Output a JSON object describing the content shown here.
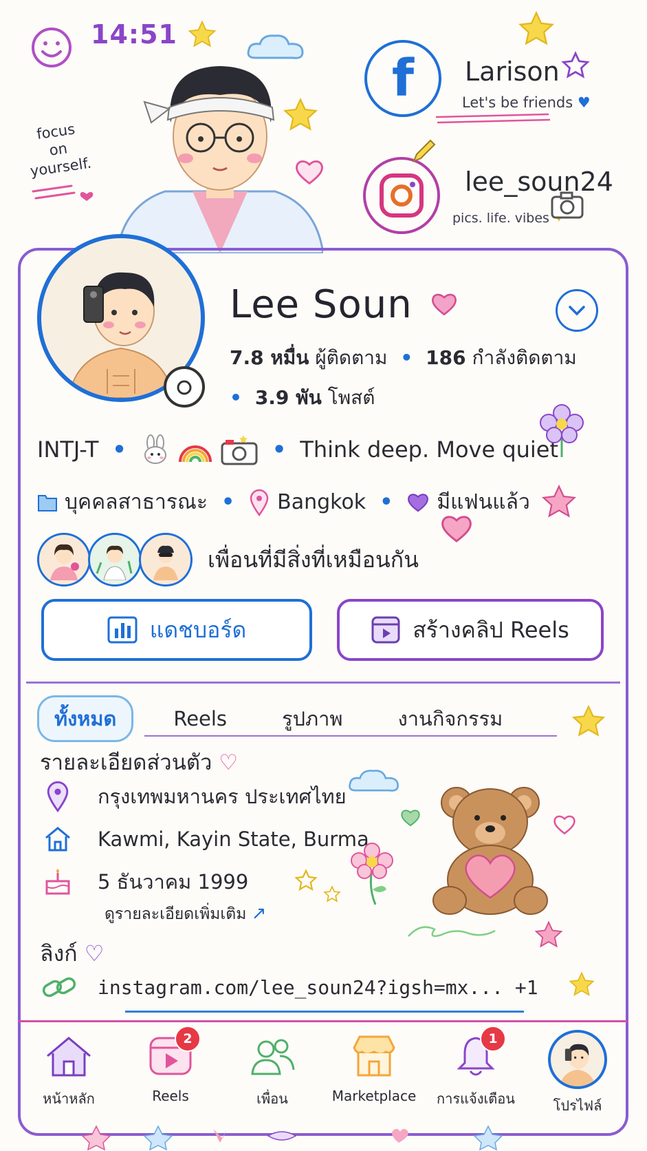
{
  "status_bar": {
    "time": "14:51"
  },
  "doodle_note": {
    "line1": "focus",
    "line2": "on",
    "line3": "yourself."
  },
  "facebook": {
    "name": "Larison",
    "tagline": "Let's be friends"
  },
  "instagram": {
    "handle": "lee_soun24",
    "tagline": "pics. life. vibes"
  },
  "profile": {
    "name": "Lee Soun",
    "followers_count": "7.8 หมื่น",
    "followers_label": "ผู้ติดตาม",
    "following_count": "186",
    "following_label": "กำลังติดตาม",
    "posts_count": "3.9 พัน",
    "posts_label": "โพสต์",
    "mbti": "INTJ-T",
    "motto": "Think deep. Move quiet",
    "category": "บุคคลสาธารณะ",
    "location": "Bangkok",
    "relationship": "มีแฟนแล้ว",
    "mutual_text": "เพื่อนที่มีสิ่งที่เหมือนกัน"
  },
  "actions": {
    "dashboard_label": "แดชบอร์ด",
    "reels_label": "สร้างคลิป Reels"
  },
  "tabs": [
    {
      "label": "ทั้งหมด",
      "active": true
    },
    {
      "label": "Reels",
      "active": false
    },
    {
      "label": "รูปภาพ",
      "active": false
    },
    {
      "label": "งานกิจกรรม",
      "active": false
    }
  ],
  "details": {
    "title": "รายละเอียดส่วนตัว",
    "current_city": "กรุงเทพมหานคร ประเทศไทย",
    "hometown": "Kawmi, Kayin State, Burma",
    "birthday": "5 ธันวาคม 1999",
    "see_more": "ดูรายละเอียดเพิ่มเติม"
  },
  "links": {
    "title": "ลิงก์",
    "url": "instagram.com/lee_soun24?igsh=mx... +1"
  },
  "bottom_nav": [
    {
      "label": "หน้าหลัก",
      "icon": "home-icon",
      "badge": ""
    },
    {
      "label": "Reels",
      "icon": "reels-icon",
      "badge": "2"
    },
    {
      "label": "เพื่อน",
      "icon": "friends-icon",
      "badge": ""
    },
    {
      "label": "Marketplace",
      "icon": "marketplace-icon",
      "badge": ""
    },
    {
      "label": "การแจ้งเตือน",
      "icon": "bell-icon",
      "badge": "1"
    },
    {
      "label": "โปรไฟล์",
      "icon": "profile-avatar",
      "badge": ""
    }
  ],
  "colors": {
    "facebook_blue": "#1f6fd6",
    "accent_purple": "#8a45c8",
    "badge_red": "#e63946",
    "pink": "#e0559a"
  }
}
